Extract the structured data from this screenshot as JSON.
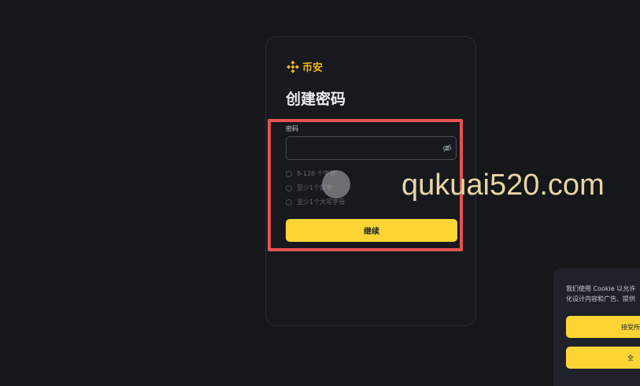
{
  "brand": {
    "logo_text": "币安",
    "accent": "#fcd535"
  },
  "page": {
    "title": "创建密码"
  },
  "password": {
    "label": "密码",
    "value": "",
    "requirements": [
      "8-128 个字符",
      "至少1个数字",
      "至少1个大写字母"
    ]
  },
  "actions": {
    "continue_label": "继续"
  },
  "watermark": {
    "text": "qukuai520.com"
  },
  "cookie_banner": {
    "text_line1": "我们使用 Cookie 以允许",
    "text_line2": "化设计内容和广告、提供",
    "accept_label": "接受所",
    "second_label": "全"
  }
}
